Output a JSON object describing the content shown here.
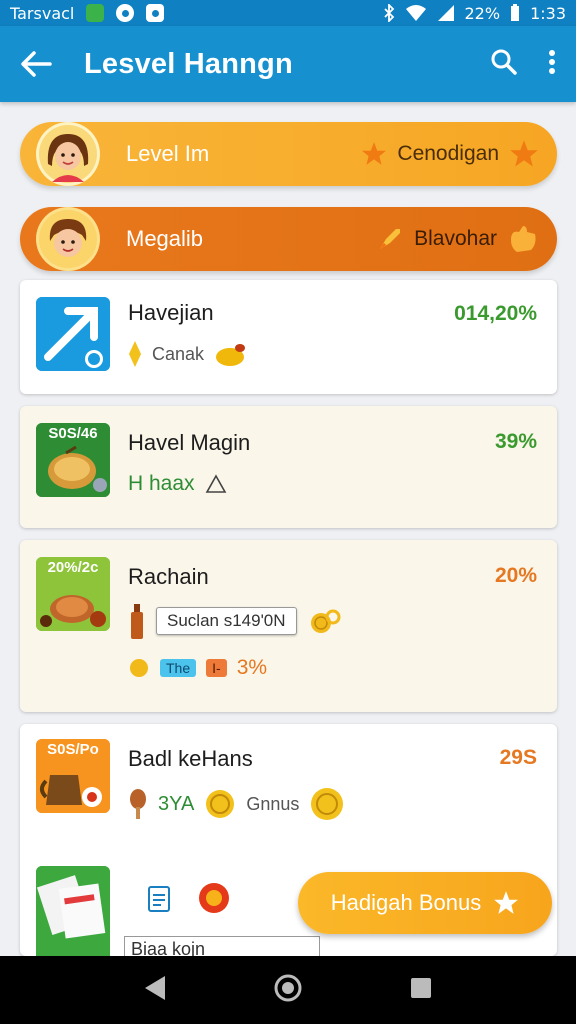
{
  "status_bar": {
    "carrier": "Tarsvacl",
    "battery": "22%",
    "time": "1:33",
    "icons": [
      "app-icon",
      "circle-icon",
      "image-icon",
      "bluetooth-icon",
      "wifi-icon",
      "signal-icon",
      "battery-icon"
    ]
  },
  "app_bar": {
    "title": "Lesvel Hanngn",
    "icons": [
      "back-arrow-icon",
      "search-icon",
      "more-vertical-icon"
    ]
  },
  "banners": [
    {
      "title": "Level Im",
      "right_text": "Cenodigan",
      "icons": [
        "girl-avatar",
        "star-icon",
        "star-icon"
      ]
    },
    {
      "title": "Megalib",
      "right_text": "Blavohar",
      "icons": [
        "boy-avatar",
        "rocket-icon",
        "hand-icon"
      ]
    }
  ],
  "cards": [
    {
      "title": "Havejian",
      "percent": "014,20%",
      "sub_text": "Canak",
      "thumb_label": "",
      "icons": [
        "arrow-app-icon",
        "diamond-icon",
        "fruit-icon"
      ]
    },
    {
      "title": "Havel Magin",
      "percent": "39%",
      "sub_text": "H haax",
      "thumb_label": "S0S/46",
      "icons": [
        "food-bowl-icon",
        "triangle-icon"
      ]
    },
    {
      "title": "Rachain",
      "percent": "20%",
      "tooltip": "Suclan s149'0N",
      "chip1": "The",
      "chip2": "I-",
      "sub_pct": "3%",
      "thumb_label": "20%/2c",
      "icons": [
        "roast-icon",
        "bottle-icon",
        "coin-icon",
        "coin-icon"
      ]
    },
    {
      "title": "Badl keHans",
      "percent": "29S",
      "sub_left": "3YA",
      "sub_text": "Gnnus",
      "thumb_label": "S0S/Po",
      "icons": [
        "teapot-icon",
        "drumstick-icon",
        "coin-icon",
        "coin-icon"
      ]
    },
    {
      "title": "",
      "sub_text": "Biaa kojn",
      "icons": [
        "cards-icon",
        "document-icon",
        "ball-icon"
      ]
    }
  ],
  "fab": {
    "label": "Hadigah Bonus",
    "icon": "star-icon"
  },
  "colors": {
    "primary": "#1790cf",
    "orange": "#f6a623",
    "dark_orange": "#e06f14",
    "green_pct": "#3a9a2e",
    "orange_pct": "#e57821"
  }
}
